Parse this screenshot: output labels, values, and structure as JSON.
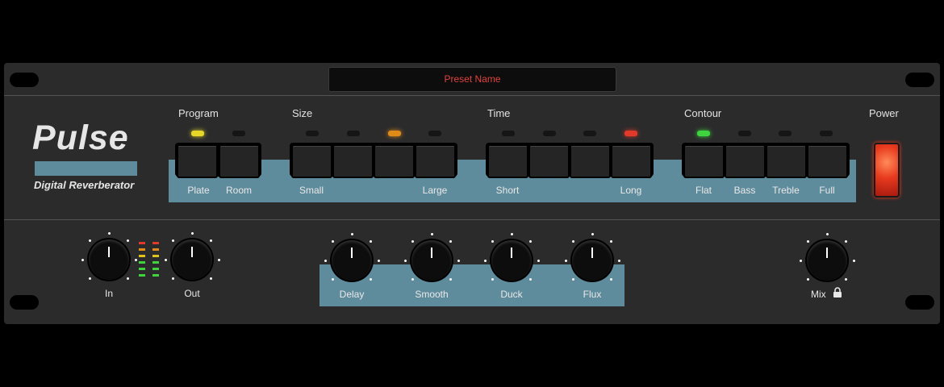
{
  "preset": {
    "name": "Preset Name"
  },
  "logo": {
    "title": "Pulse",
    "subtitle": "Digital Reverberator"
  },
  "groups": {
    "program": {
      "label": "Program",
      "buttons": [
        "Plate",
        "Room"
      ],
      "active_index": 0,
      "led_color": "#e8d629"
    },
    "size": {
      "label": "Size",
      "buttons": [
        "Small",
        "",
        "",
        "Large"
      ],
      "active_index": 2,
      "led_color": "#e08a1a"
    },
    "time": {
      "label": "Time",
      "buttons": [
        "Short",
        "",
        "",
        "Long"
      ],
      "active_index": 3,
      "led_color": "#e23a2a"
    },
    "contour": {
      "label": "Contour",
      "buttons": [
        "Flat",
        "Bass",
        "Treble",
        "Full"
      ],
      "active_index": 0,
      "led_color": "#3fd33f"
    }
  },
  "power": {
    "label": "Power",
    "state": "on"
  },
  "knobs": {
    "in": {
      "label": "In"
    },
    "out": {
      "label": "Out"
    },
    "delay": {
      "label": "Delay"
    },
    "smooth": {
      "label": "Smooth"
    },
    "duck": {
      "label": "Duck"
    },
    "flux": {
      "label": "Flux"
    },
    "mix": {
      "label": "Mix",
      "lock_icon": "lock-icon"
    }
  },
  "colors": {
    "panel": "#2b2b2c",
    "accent_blue": "#5f8c9c",
    "preset_text": "#e0433d"
  }
}
